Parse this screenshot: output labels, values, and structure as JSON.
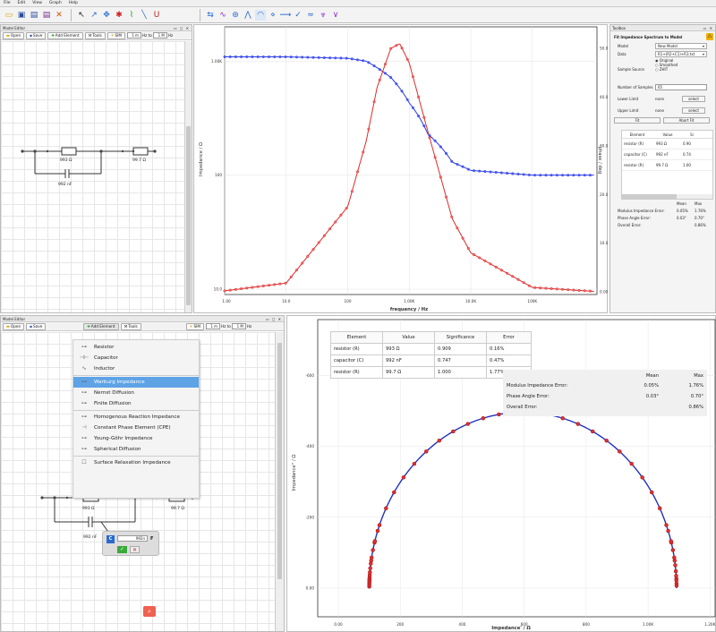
{
  "menu": [
    "File",
    "Edit",
    "View",
    "Graph",
    "Help"
  ],
  "model_editor_top": {
    "title": "Model Editor",
    "open": "Open",
    "save": "Save",
    "add_element": "Add Element",
    "tools": "Tools",
    "sim": "SIM",
    "from": "1 m",
    "hz_to": "Hz to",
    "to": "1 M",
    "hz": "Hz",
    "r1": "993 Ω",
    "r2": "99.7 Ω",
    "c1": "992 nF"
  },
  "bode": {
    "ylabel_left": "Impedance / Ω",
    "ylabel_right": "-phase / deg",
    "xlabel": "frequency / Hz",
    "xticks": [
      "1.00",
      "10.0",
      "100",
      "1.00K",
      "10.0K",
      "100K"
    ],
    "yticks_left": [
      "10.0",
      "100",
      "1.00K"
    ],
    "yticks_right": [
      "0.00",
      "10.0",
      "20.0",
      "30.0",
      "40.0",
      "50.0"
    ]
  },
  "toolbox": {
    "title": "Toolbox",
    "subtitle": "Fit Impedance Spectrum to Model",
    "model_label": "Model",
    "model_value": "New Model",
    "data_label": "Data",
    "data_value": "R1+(R2+C1)+R3.txt",
    "sample_label": "Sample Source",
    "opt_original": "Original",
    "opt_smoothed": "Smoothed",
    "opt_zhit": "ZHIT",
    "samples_label": "Number of Samples",
    "samples_value": "65",
    "lower_label": "Lower Limit",
    "lower_value": "none",
    "upper_label": "Upper Limit",
    "upper_value": "none",
    "select": "select",
    "fit": "Fit",
    "abort": "Abort Fit",
    "cols": [
      "Element",
      "Value",
      "Si"
    ],
    "rows": [
      [
        "resistor (R)",
        "993 Ω",
        "0.90"
      ],
      [
        "capacitor (C)",
        "992 nF",
        "0.74"
      ],
      [
        "resistor (R)",
        "99.7 Ω",
        "1.00"
      ]
    ],
    "err_cols": [
      "Mean",
      "Max"
    ],
    "errs": [
      [
        "Modulus Impedance Error:",
        "0.05%",
        "1.76%"
      ],
      [
        "Phase Angle Error:",
        "0.03°",
        "0.70°"
      ],
      [
        "Overall Error:",
        "",
        "0.86%"
      ]
    ]
  },
  "model_editor_bottom": {
    "title": "Model Editor",
    "open": "Open",
    "save": "Save",
    "add_element": "Add Element",
    "tools": "Tools",
    "sim": "SIM",
    "from": "1 m",
    "hz_to": "Hz to",
    "to": "1 M",
    "hz": "Hz",
    "r1": "993 Ω",
    "r2": "99.7 Ω",
    "c1": "992 nF",
    "edit_letter": "C",
    "edit_value": "992n",
    "edit_unit": "F"
  },
  "element_menu": [
    {
      "label": "Resistor",
      "icon": "resistor-icon",
      "glyph": "⊶"
    },
    {
      "label": "Capacitor",
      "icon": "capacitor-icon",
      "glyph": "⊣⊢"
    },
    {
      "label": "Inductor",
      "icon": "inductor-icon",
      "glyph": "∿"
    },
    {
      "sep": true
    },
    {
      "label": "Warburg Impedance",
      "icon": "warburg-icon",
      "glyph": "⊶",
      "sel": true
    },
    {
      "label": "Nernst Diffusion",
      "icon": "nernst-icon",
      "glyph": "⊶"
    },
    {
      "label": "Finite Diffusion",
      "icon": "finite-diffusion-icon",
      "glyph": "⊶"
    },
    {
      "sep": true
    },
    {
      "label": "Homogenous Reaction Impedance",
      "icon": "homogenous-reaction-icon",
      "glyph": "⊶"
    },
    {
      "label": "Constant Phase Element (CPE)",
      "icon": "cpe-icon",
      "glyph": "⊣"
    },
    {
      "label": "Young-Göhr Impedance",
      "icon": "young-gohr-icon",
      "glyph": "⊶"
    },
    {
      "label": "Spherical Diffusion",
      "icon": "spherical-diffusion-icon",
      "glyph": "⊶"
    },
    {
      "sep": true
    },
    {
      "label": "Surface Relaxation Impedance",
      "icon": "surface-relaxation-icon",
      "glyph": "☐"
    }
  ],
  "fit_table": {
    "cols": [
      "Element",
      "Value",
      "Significance",
      "Error"
    ],
    "rows": [
      [
        "resistor (R)",
        "993 Ω",
        "0.909",
        "0.16%"
      ],
      [
        "capacitor (C)",
        "992 nF",
        "0.747",
        "0.47%"
      ],
      [
        "resistor (R)",
        "99.7 Ω",
        "1.000",
        "1.77%"
      ]
    ]
  },
  "err_table": {
    "cols": [
      "Mean",
      "Max"
    ],
    "rows": [
      [
        "Modulus Impedance Error:",
        "0.05%",
        "1.76%"
      ],
      [
        "Phase Angle Error:",
        "0.03°",
        "0.70°"
      ],
      [
        "Overall Error:",
        "",
        "0.86%"
      ]
    ]
  },
  "nyquist": {
    "xlabel": "Impedance' / Ω",
    "ylabel": "Impedance'' / Ω",
    "xticks": [
      "0.00",
      "200",
      "400",
      "600",
      "800",
      "1.00K",
      "1.20K"
    ],
    "yticks": [
      "0.00",
      "-200",
      "-400",
      "-600",
      "-800"
    ]
  },
  "chart_data": [
    {
      "type": "line",
      "title": "",
      "xlabel": "frequency / Hz",
      "ylabel": "Impedance / Ω",
      "y2label": "-phase / deg",
      "xscale": "log",
      "xlim": [
        1,
        1000000
      ],
      "ylim": [
        10,
        2000
      ],
      "y2lim": [
        0,
        55
      ],
      "series": [
        {
          "x": [
            1,
            10,
            100,
            200,
            500,
            1000,
            2000,
            5000,
            10000,
            100000,
            1000000
          ],
          "values": [
            1092,
            1091,
            1060,
            1000,
            720,
            430,
            230,
            130,
            110,
            100,
            100
          ]
        },
        {
          "x": [
            1,
            10,
            100,
            200,
            300,
            500,
            700,
            1000,
            2000,
            5000,
            10000,
            100000,
            1000000
          ],
          "values": [
            0.2,
            1.8,
            17.5,
            31,
            42,
            50,
            51,
            47,
            33,
            15,
            8,
            0.9,
            0.1
          ],
          "axis": "y2"
        }
      ]
    },
    {
      "type": "line",
      "title": "",
      "xlabel": "Impedance' / Ω",
      "ylabel": "Impedance'' / Ω",
      "xlim": [
        0,
        1200
      ],
      "ylim": [
        0,
        -870
      ],
      "series": [
        {
          "x": [
            100,
            100,
            103,
            110,
            125,
            150,
            200,
            265,
            320,
            390,
            490,
            590,
            600,
            700,
            790,
            850,
            900,
            940,
            980,
            1000,
            1040,
            1080,
            1090,
            1092
          ],
          "values": [
            0,
            -20,
            -60,
            -100,
            -150,
            -200,
            -270,
            -330,
            -380,
            -420,
            -460,
            -490,
            -490,
            -480,
            -455,
            -425,
            -395,
            -355,
            -300,
            -260,
            -210,
            -120,
            -50,
            0
          ]
        }
      ]
    }
  ]
}
